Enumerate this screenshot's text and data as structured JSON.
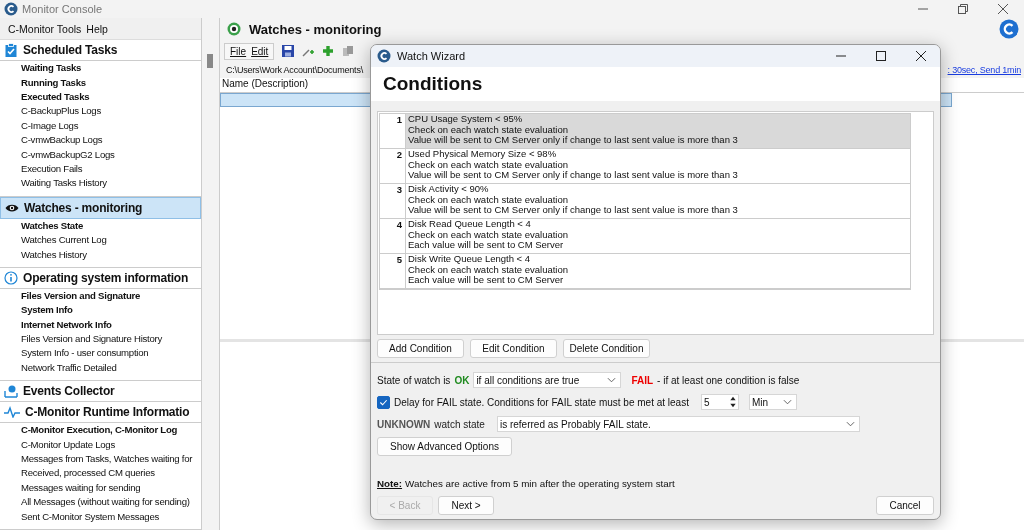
{
  "window": {
    "title": "Monitor Console"
  },
  "sidebar": {
    "menu": [
      "C-Monitor Tools",
      "Help"
    ],
    "sections": [
      {
        "kind": "tasks",
        "title": "Scheduled Tasks",
        "selected": false,
        "items": [
          {
            "label": "Waiting Tasks",
            "bold": true
          },
          {
            "label": "Running Tasks",
            "bold": true
          },
          {
            "label": "Executed Tasks",
            "bold": true
          },
          {
            "label": "C-BackupPlus Logs",
            "bold": false
          },
          {
            "label": "C-Image Logs",
            "bold": false
          },
          {
            "label": "C-vmwBackup Logs",
            "bold": false
          },
          {
            "label": "C-vmwBackupG2 Logs",
            "bold": false
          },
          {
            "label": "Execution Fails",
            "bold": false
          },
          {
            "label": "Waiting Tasks History",
            "bold": false
          }
        ]
      },
      {
        "kind": "watch",
        "title": "Watches - monitoring",
        "selected": true,
        "items": [
          {
            "label": "Watches State",
            "bold": true
          },
          {
            "label": "Watches Current Log",
            "bold": false
          },
          {
            "label": "Watches History",
            "bold": false
          }
        ]
      },
      {
        "kind": "info",
        "title": "Operating system information",
        "selected": false,
        "items": [
          {
            "label": "Files Version and Signature",
            "bold": true
          },
          {
            "label": "System Info",
            "bold": true
          },
          {
            "label": "Internet Network Info",
            "bold": true
          },
          {
            "label": "Files Version and Signature History",
            "bold": false
          },
          {
            "label": "System Info - user consumption",
            "bold": false
          },
          {
            "label": "Network Traffic Detailed",
            "bold": false
          }
        ]
      },
      {
        "kind": "events",
        "title": "Events Collector",
        "selected": false
      },
      {
        "kind": "runtime",
        "title": "C-Monitor Runtime Informatio",
        "selected": false,
        "items": [
          {
            "label": "C-Monitor Execution, C-Monitor Log",
            "bold": true
          },
          {
            "label": "C-Monitor Update Logs",
            "bold": false
          },
          {
            "label": "Messages from Tasks, Watches waiting for",
            "bold": false
          },
          {
            "label": "Received, processed CM queries",
            "bold": false
          },
          {
            "label": "Messages waiting for sending",
            "bold": false
          },
          {
            "label": "All Messages (without waiting for sending)",
            "bold": false
          },
          {
            "label": "Sent C-Monitor System Messages",
            "bold": false
          }
        ]
      }
    ]
  },
  "panel": {
    "title": "Watches - monitoring",
    "menu": [
      "File",
      "Edit"
    ],
    "path": "C:\\Users\\Work Account\\Documents\\",
    "link": ": 30sec, Send 1min",
    "column": "Name (Description)"
  },
  "dialog": {
    "title": "Watch Wizard",
    "heading": "Conditions",
    "conditions": [
      {
        "number": "1",
        "lines": [
          "CPU Usage System < 95%",
          "Check on each watch state evaluation",
          "Value will be sent to CM Server only if change to last sent value is more than 3"
        ],
        "selected": true
      },
      {
        "number": "2",
        "lines": [
          "Used Physical Memory Size < 98%",
          "Check on each watch state evaluation",
          "Value will be sent to CM Server only if change to last sent value is more than 3"
        ],
        "selected": false
      },
      {
        "number": "3",
        "lines": [
          "Disk Activity < 90%",
          "Check on each watch state evaluation",
          "Value will be sent to CM Server only if change to last sent value is more than 3"
        ],
        "selected": false
      },
      {
        "number": "4",
        "lines": [
          "Disk Read Queue Length < 4",
          "Check on each watch state evaluation",
          "Each value will be sent to CM Server"
        ],
        "selected": false
      },
      {
        "number": "5",
        "lines": [
          "Disk Write Queue Length < 4",
          "Check on each watch state evaluation",
          "Each value will be sent to CM Server"
        ],
        "selected": false
      }
    ],
    "condition_buttons": [
      "Add Condition",
      "Edit Condition",
      "Delete Condition"
    ],
    "state": {
      "label": "State of watch is",
      "ok": "OK",
      "value": "if all conditions are true",
      "fail": "FAIL",
      "fail_text": "- if at least one condition is false"
    },
    "delay": {
      "checked": true,
      "label": "Delay for FAIL state. Conditions for FAIL state must be met at least",
      "value": "5",
      "unit": "Min"
    },
    "unknown": {
      "label": "UNKNOWN",
      "label_rest": "watch state",
      "value": "is referred as Probably FAIL state."
    },
    "advanced_button": "Show Advanced Options",
    "note": {
      "label": "Note:",
      "text": "Watches are active from 5 min after the operating system start"
    },
    "nav": [
      {
        "label": "< Back",
        "disabled": true
      },
      {
        "label": "Next >",
        "disabled": false
      }
    ],
    "cancel": "Cancel"
  }
}
